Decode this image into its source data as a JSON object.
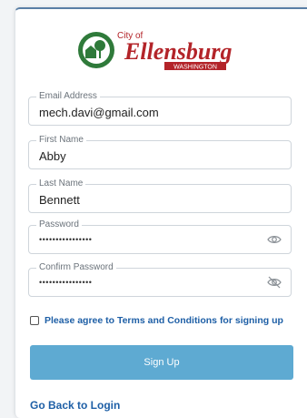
{
  "logo": {
    "city_of": "City of",
    "name": "Ellensburg",
    "state": "WASHINGTON"
  },
  "form": {
    "email": {
      "label": "Email Address",
      "value": "mech.davi@gmail.com"
    },
    "first_name": {
      "label": "First Name",
      "value": "Abby"
    },
    "last_name": {
      "label": "Last Name",
      "value": "Bennett"
    },
    "password": {
      "label": "Password",
      "value": "••••••••••••••••",
      "icon": "eye-icon"
    },
    "confirm_password": {
      "label": "Confirm Password",
      "value": "••••••••••••••••",
      "icon": "eye-off-icon"
    }
  },
  "agree_text": "Please agree to Terms and Conditions for signing up",
  "signup_label": "Sign Up",
  "back_link": "Go Back to Login",
  "colors": {
    "brand_red": "#b32429",
    "brand_green": "#2f7a3a",
    "link_blue": "#1e5fa6",
    "button_blue": "#5eaad2"
  }
}
